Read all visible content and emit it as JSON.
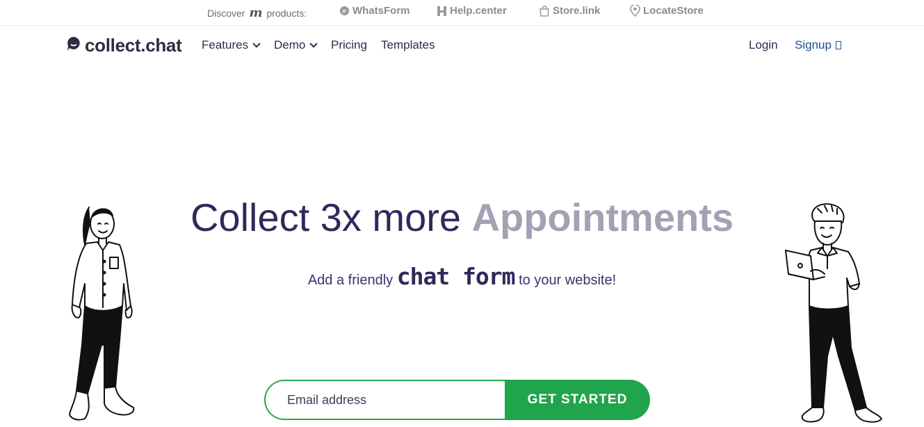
{
  "topbar": {
    "discover_prefix": "Discover",
    "discover_suffix": "products:",
    "products": [
      {
        "label": "WhatsForm",
        "icon": "whatsapp-icon"
      },
      {
        "label": "Help.center",
        "icon": "help-h-icon"
      },
      {
        "label": "Store.link",
        "icon": "shopping-bag-icon"
      },
      {
        "label": "LocateStore",
        "icon": "map-pin-icon"
      }
    ]
  },
  "nav": {
    "logo": "collect.chat",
    "items": [
      {
        "label": "Features"
      },
      {
        "label": "Demo"
      },
      {
        "label": "Pricing"
      },
      {
        "label": "Templates"
      }
    ],
    "login": "Login",
    "signup": "Signup"
  },
  "hero": {
    "headline_prefix": "Collect 3x more",
    "headline_highlight": "Appointments",
    "sub_prefix": "Add a friendly",
    "sub_highlight": "chat form",
    "sub_suffix": "to your website!"
  },
  "signup_form": {
    "email_placeholder": "Email address",
    "cta_label": "GET STARTED"
  },
  "colors": {
    "primary_text": "#2d2a5b",
    "highlight_gray": "#a3a1b4",
    "cta_green": "#21a54c",
    "signup_blue": "#1e4f8f"
  }
}
